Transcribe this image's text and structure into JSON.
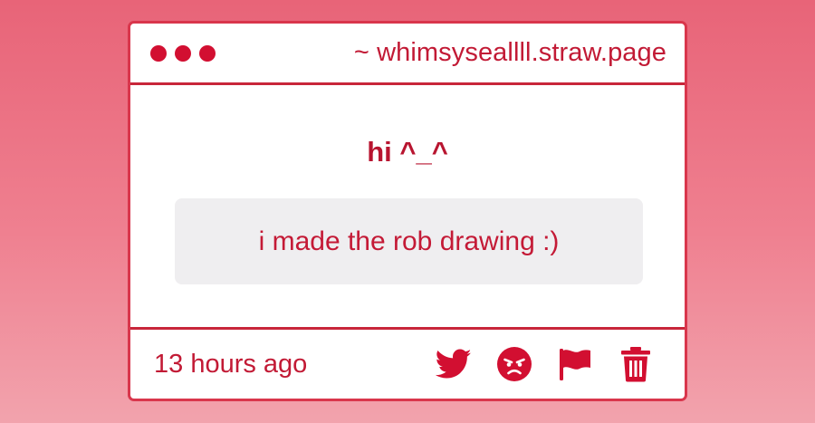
{
  "window": {
    "url": "~ whimsyseallll.straw.page",
    "dots": [
      "close-dot",
      "minimize-dot",
      "maximize-dot"
    ]
  },
  "post": {
    "question": "hi ^_^",
    "answer": "i made the rob drawing :)",
    "timestamp": "13 hours ago"
  },
  "actions": [
    {
      "name": "share-twitter",
      "icon": "twitter-icon"
    },
    {
      "name": "react-angry",
      "icon": "angry-face-icon"
    },
    {
      "name": "report",
      "icon": "flag-icon"
    },
    {
      "name": "delete",
      "icon": "trash-icon"
    }
  ],
  "colors": {
    "accent": "#d20f31",
    "border": "#d9364c",
    "answer_bg": "#efeef0",
    "background_top": "#e86478",
    "background_bottom": "#f2a3ad"
  }
}
